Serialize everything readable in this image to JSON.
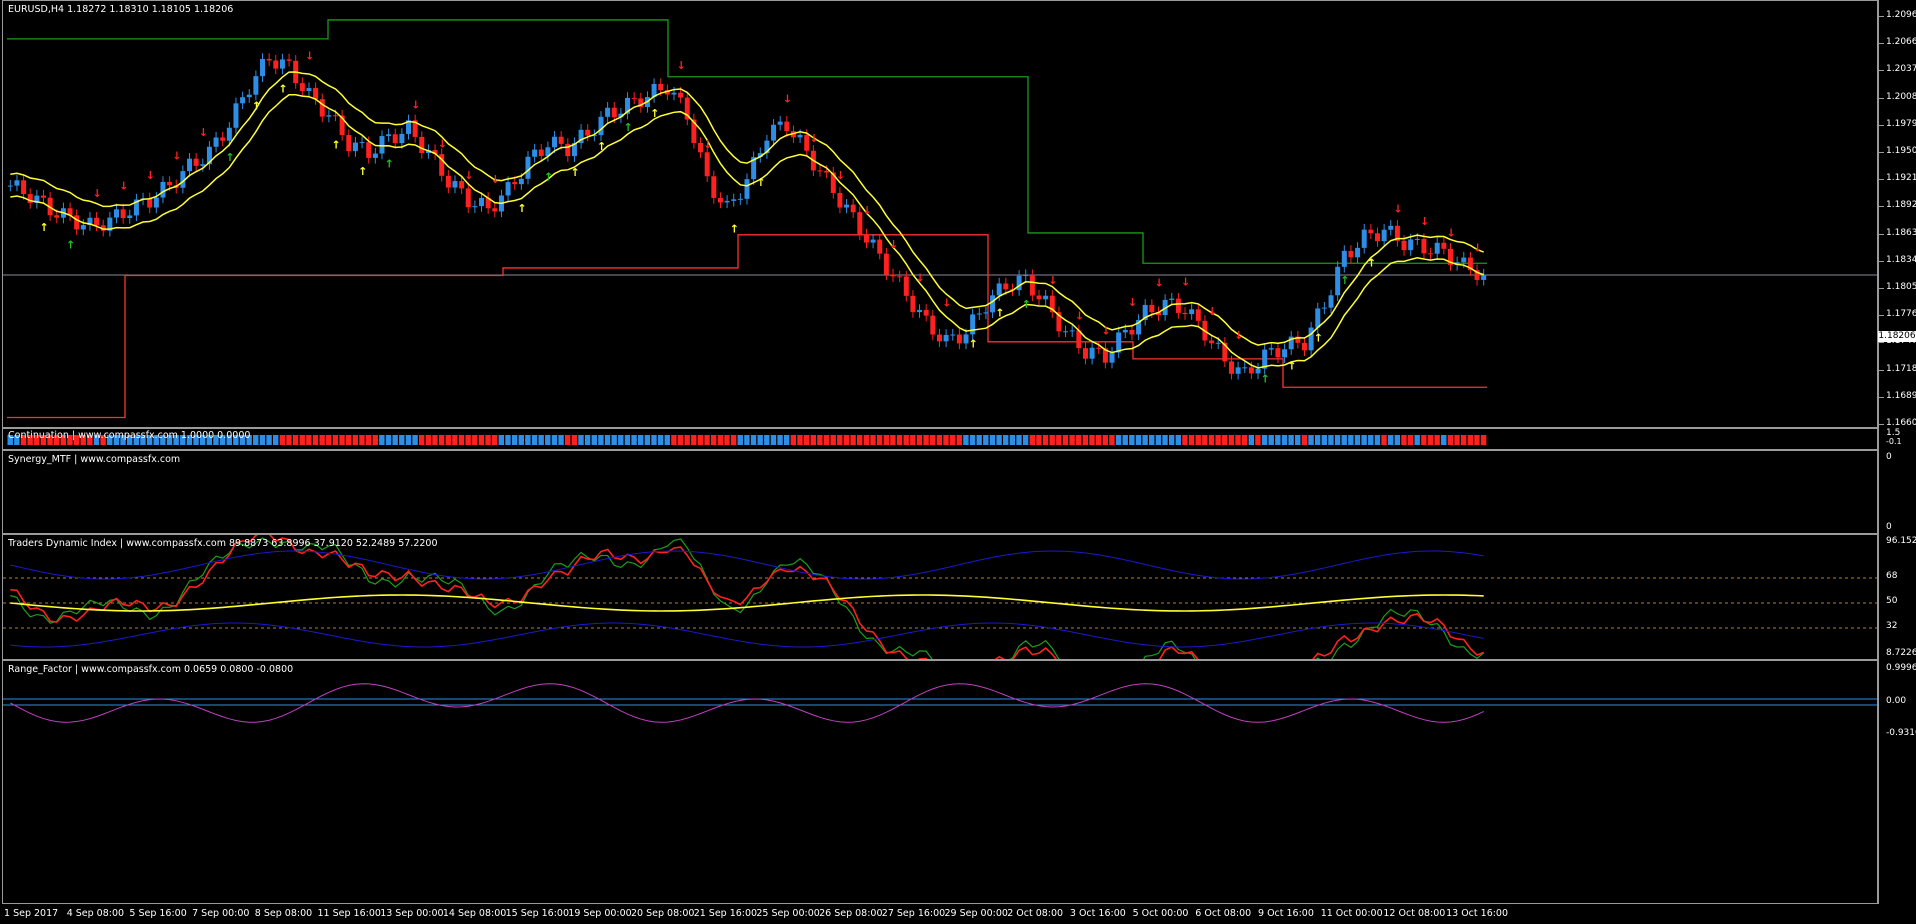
{
  "main": {
    "symbol_line": "EURUSD,H4  1.18272 1.18310 1.18105 1.18206",
    "current_price": "1.18206",
    "price_labels": [
      "1.20960",
      "1.20665",
      "1.20375",
      "1.20085",
      "1.19795",
      "1.19505",
      "1.19215",
      "1.18925",
      "1.18635",
      "1.18345",
      "1.18055",
      "1.17760",
      "1.17470",
      "1.17180",
      "1.16890",
      "1.16600"
    ]
  },
  "continuation": {
    "title": "Continuation | www.compassfx.com  1.0000 0.0000",
    "scale": [
      "1.5",
      "-0.1"
    ],
    "scale_small": "1.0"
  },
  "synergy": {
    "title": "Synergy_MTF | www.compassfx.com",
    "scale": [
      "0",
      "0"
    ]
  },
  "tdi": {
    "title": "Traders Dynamic Index | www.compassfx.com   89.8873 63.8996 37.9120 52.2489 57.2200",
    "scale": [
      "96.1529",
      "68",
      "50",
      "32",
      "8.7226"
    ]
  },
  "range_factor": {
    "title": "Range_Factor | www.compassfx.com   0.0659 0.0800 -0.0800",
    "scale": [
      "0.9996",
      "0.00",
      "-0.9316"
    ]
  },
  "time_axis": [
    "1 Sep 2017",
    "4 Sep 08:00",
    "5 Sep 16:00",
    "7 Sep 00:00",
    "8 Sep 08:00",
    "11 Sep 16:00",
    "13 Sep 00:00",
    "14 Sep 08:00",
    "15 Sep 16:00",
    "19 Sep 00:00",
    "20 Sep 08:00",
    "21 Sep 16:00",
    "25 Sep 00:00",
    "26 Sep 08:00",
    "27 Sep 16:00",
    "29 Sep 00:00",
    "2 Oct 08:00",
    "3 Oct 16:00",
    "5 Oct 00:00",
    "6 Oct 08:00",
    "9 Oct 16:00",
    "11 Oct 00:00",
    "12 Oct 08:00",
    "13 Oct 16:00"
  ],
  "colors": {
    "bull": "#2e8ee6",
    "bear": "#ff2020",
    "ma": "#ffff33",
    "tdi_green": "#1aa01a",
    "tdi_red": "#ff2020",
    "tdi_blue": "#1a1ad0",
    "range": "#c040c0",
    "range_line": "#2e8ee6",
    "support": "#ff3030",
    "resistance": "#1a9a1a"
  },
  "chart_data": {
    "type": "candlestick",
    "title": "EURUSD,H4",
    "ylim": [
      1.166,
      1.211
    ],
    "close_series_approx": [
      1.1915,
      1.1905,
      1.189,
      1.188,
      1.1872,
      1.1878,
      1.189,
      1.19,
      1.1915,
      1.1935,
      1.195,
      1.198,
      1.202,
      1.205,
      1.204,
      1.201,
      1.199,
      1.196,
      1.195,
      1.1965,
      1.1975,
      1.195,
      1.192,
      1.19,
      1.189,
      1.191,
      1.194,
      1.196,
      1.1955,
      1.197,
      1.199,
      1.2,
      1.201,
      1.202,
      1.199,
      1.192,
      1.189,
      1.192,
      1.197,
      1.198,
      1.195,
      1.192,
      1.189,
      1.186,
      1.183,
      1.18,
      1.177,
      1.175,
      1.176,
      1.179,
      1.181,
      1.1815,
      1.179,
      1.176,
      1.174,
      1.1735,
      1.176,
      1.178,
      1.179,
      1.1785,
      1.176,
      1.173,
      1.1715,
      1.1735,
      1.1745,
      1.175,
      1.179,
      1.184,
      1.186,
      1.1868,
      1.1855,
      1.185,
      1.1845,
      1.183,
      1.1821
    ]
  }
}
